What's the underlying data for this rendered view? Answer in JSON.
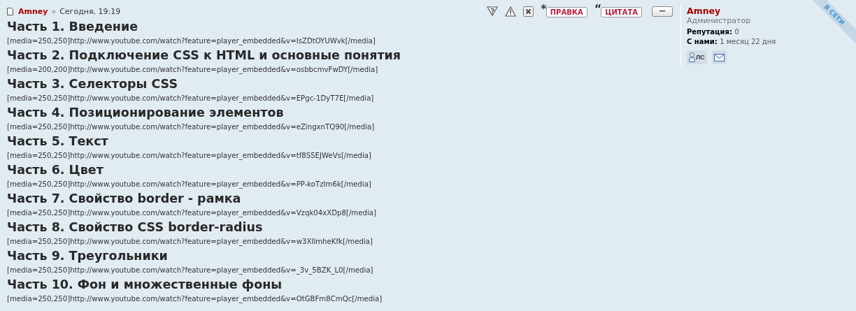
{
  "post_header": {
    "author": "Amney",
    "separator": "»",
    "time": "Сегодня, 19:19"
  },
  "actions": [
    {
      "kind": "report-icon"
    },
    {
      "kind": "warn-icon"
    },
    {
      "kind": "delete-icon"
    },
    {
      "kind": "text",
      "mark": "*",
      "label": "ПРАВКА"
    },
    {
      "kind": "text",
      "mark": "“",
      "label": "ЦИТАТА"
    },
    {
      "kind": "collapse"
    }
  ],
  "sections": [
    {
      "heading": "Часть 1. Введение",
      "media": "[media=250,250]http://www.youtube.com/watch?feature=player_embedded&v=IsZDtOYUWvk[/media]"
    },
    {
      "heading": "Часть 2. Подключение CSS к HTML и основные понятия",
      "media": "[media=200,200]http://www.youtube.com/watch?feature=player_embedded&v=osbbcmvFwDY[/media]"
    },
    {
      "heading": "Часть 3. Селекторы CSS",
      "media": "[media=250,250]http://www.youtube.com/watch?feature=player_embedded&v=EPgc-1DyT7E[/media]"
    },
    {
      "heading": "Часть 4. Позиционирование элементов",
      "media": "[media=250,250]http://www.youtube.com/watch?feature=player_embedded&v=eZingxnTQ90[/media]"
    },
    {
      "heading": "Часть 5. Текст",
      "media": "[media=250,250]http://www.youtube.com/watch?feature=player_embedded&v=tf8S5EJWeVs[/media]"
    },
    {
      "heading": "Часть 6. Цвет",
      "media": "[media=250,250]http://www.youtube.com/watch?feature=player_embedded&v=PP-koTzIm6k[/media]"
    },
    {
      "heading": "Часть 7. Свойство border - рамка",
      "media": "[media=250,250]http://www.youtube.com/watch?feature=player_embedded&v=Vzqk04xXDp8[/media]"
    },
    {
      "heading": "Часть 8. Свойство CSS border-radius",
      "media": "[media=250,250]http://www.youtube.com/watch?feature=player_embedded&v=w3XIlmheKfk[/media]"
    },
    {
      "heading": "Часть 9. Треугольники",
      "media": "[media=250,250]http://www.youtube.com/watch?feature=player_embedded&v=_3v_5BZK_L0[/media]"
    },
    {
      "heading": "Часть 10. Фон и множественные фоны",
      "media": "[media=250,250]http://www.youtube.com/watch?feature=player_embedded&v=OtGBFm8CmQc[/media]"
    }
  ],
  "profile": {
    "name": "Amney",
    "rank": "Администратор",
    "online": true,
    "online_label": "В СЕТИ",
    "stats": [
      {
        "label": "Репутация:",
        "value": "0"
      },
      {
        "label": "С нами:",
        "value": "1 месяц 22 дня"
      }
    ],
    "pm_label": "ЛС"
  }
}
